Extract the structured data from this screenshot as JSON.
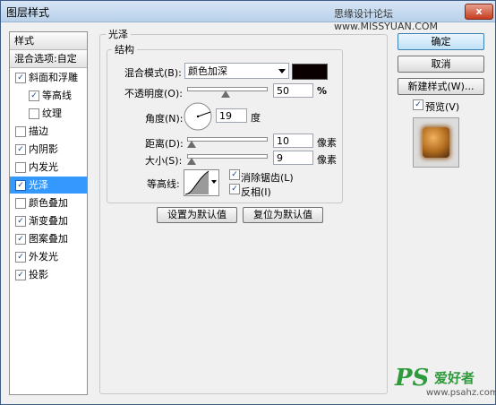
{
  "window": {
    "title": "图层样式",
    "watermark": "思缘设计论坛 www.MISSYUAN.COM",
    "close": "x"
  },
  "left_panel": {
    "header": "样式",
    "blend_options": "混合选项:自定",
    "items": [
      {
        "label": "斜面和浮雕",
        "checked": true,
        "check": "✓"
      },
      {
        "label": "等高线",
        "checked": true,
        "check": "✓"
      },
      {
        "label": "纹理",
        "checked": false,
        "check": ""
      },
      {
        "label": "描边",
        "checked": false,
        "check": ""
      },
      {
        "label": "内阴影",
        "checked": true,
        "check": "✓"
      },
      {
        "label": "内发光",
        "checked": false,
        "check": ""
      },
      {
        "label": "光泽",
        "checked": true,
        "check": "✓",
        "selected": true
      },
      {
        "label": "颜色叠加",
        "checked": false,
        "check": ""
      },
      {
        "label": "渐变叠加",
        "checked": true,
        "check": "✓"
      },
      {
        "label": "图案叠加",
        "checked": true,
        "check": "✓"
      },
      {
        "label": "外发光",
        "checked": true,
        "check": "✓"
      },
      {
        "label": "投影",
        "checked": true,
        "check": "✓"
      }
    ]
  },
  "satin": {
    "group_title": "光泽",
    "structure_title": "结构",
    "blend_mode_label": "混合模式(B):",
    "blend_mode_value": "颜色加深",
    "color": "#0a0000",
    "opacity_label": "不透明度(O):",
    "opacity_value": "50",
    "opacity_unit": "%",
    "angle_label": "角度(N):",
    "angle_value": "19",
    "angle_unit": "度",
    "distance_label": "距离(D):",
    "distance_value": "10",
    "distance_unit": "像素",
    "size_label": "大小(S):",
    "size_value": "9",
    "size_unit": "像素",
    "contour_label": "等高线:",
    "anti_alias_label": "消除锯齿(L)",
    "anti_alias_check": "✓",
    "invert_label": "反相(I)",
    "invert_check": "✓",
    "make_default": "设置为默认值",
    "reset_default": "复位为默认值"
  },
  "right_panel": {
    "ok": "确定",
    "cancel": "取消",
    "new_style": "新建样式(W)...",
    "preview_label": "预览(V)",
    "preview_check": "✓"
  },
  "branding": {
    "ps": "PS",
    "site_cn": "爱好者",
    "url": "www.psahz.com"
  }
}
